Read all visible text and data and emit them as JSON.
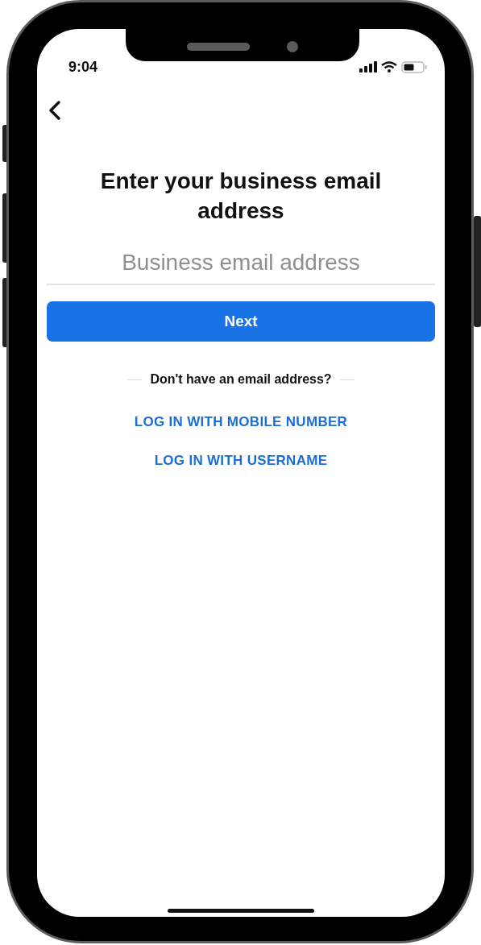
{
  "status_bar": {
    "time": "9:04"
  },
  "title": "Enter your business email address",
  "email_field": {
    "placeholder": "Business email address"
  },
  "next_button": {
    "label": "Next"
  },
  "alternative_prompt": "Don't have an email address?",
  "links": [
    {
      "label": "LOG IN WITH MOBILE NUMBER"
    },
    {
      "label": "LOG IN WITH USERNAME"
    }
  ]
}
